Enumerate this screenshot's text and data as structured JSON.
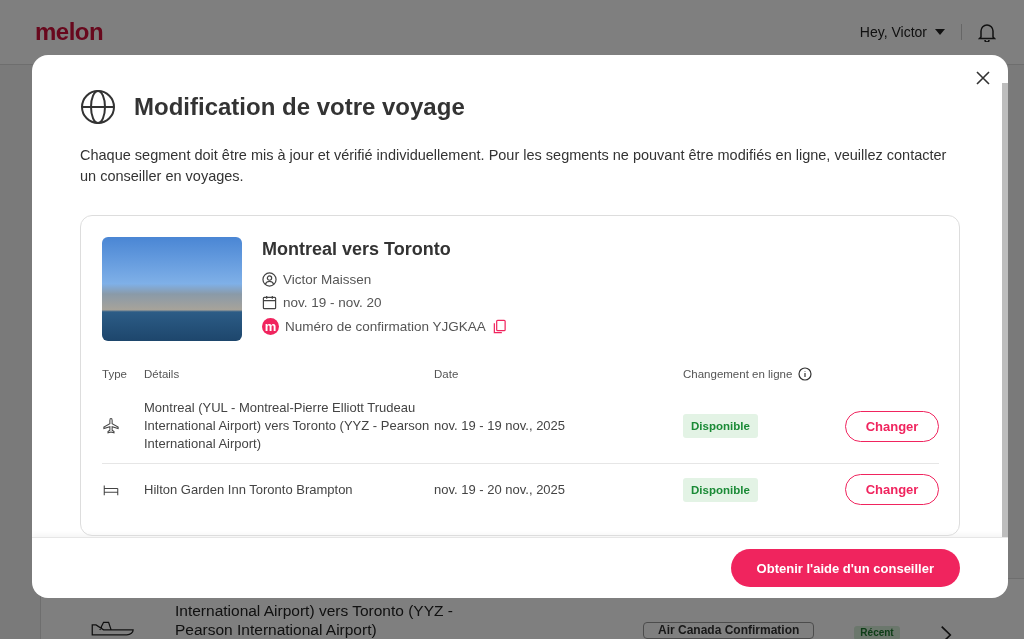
{
  "header": {
    "logo": "melon",
    "user_menu": "Hey, Victor"
  },
  "background_trip": {
    "lines": [
      "International Airport) vers Toronto (YYZ -",
      "Pearson International Airport)"
    ],
    "confirmation": "Air Canada Confirmation",
    "badge": "Récent"
  },
  "modal": {
    "title": "Modification de votre voyage",
    "description": "Chaque segment doit être mis à jour et vérifié individuellement. Pour les segments ne pouvant être modifiés en ligne, veuillez contacter un conseiller en voyages.",
    "trip": {
      "title": "Montreal vers Toronto",
      "traveler": "Victor Maissen",
      "dates": "nov. 19 - nov. 20",
      "brand_mark": "m",
      "confirmation": "Numéro de confirmation YJGKAA"
    },
    "table": {
      "columns": [
        "Type",
        "Détails",
        "Date",
        "Changement en ligne"
      ],
      "rows": [
        {
          "kind": "flight",
          "details": "Montreal (YUL - Montreal-Pierre Elliott Trudeau International Airport) vers Toronto (YYZ - Pearson International Airport)",
          "date": "nov. 19 - 19 nov., 2025",
          "status": "Disponible",
          "action": "Changer"
        },
        {
          "kind": "hotel",
          "details": "Hilton Garden Inn Toronto Brampton",
          "date": "nov. 19 - 20 nov., 2025",
          "status": "Disponible",
          "action": "Changer"
        }
      ]
    },
    "help_button": "Obtenir l'aide d'un conseiller"
  }
}
